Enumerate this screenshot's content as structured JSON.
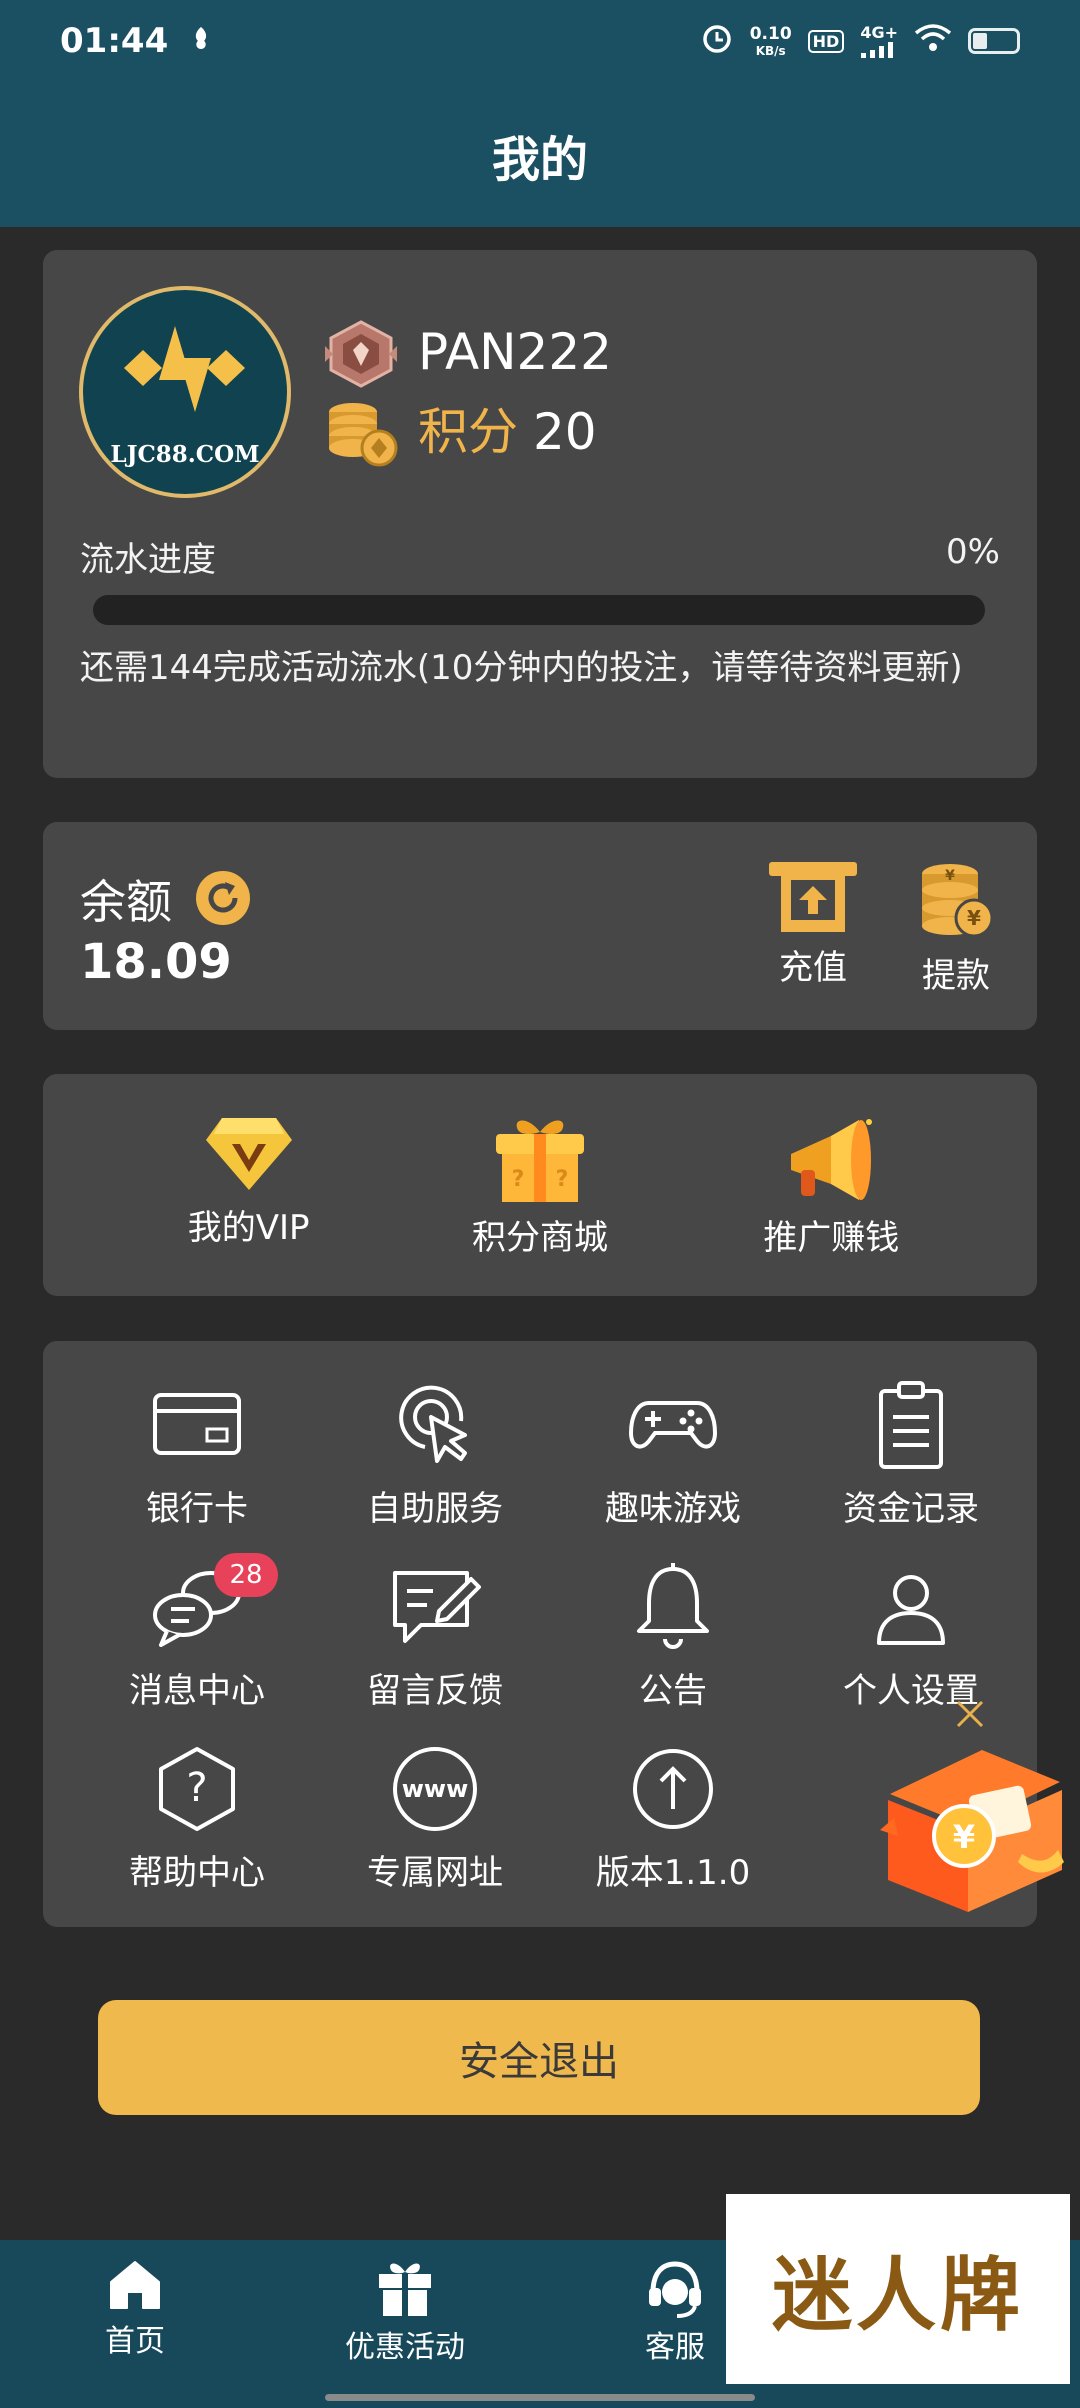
{
  "status_bar": {
    "time": "01:44",
    "net_speed_value": "0.10",
    "net_speed_unit": "KB/s",
    "hd": "HD",
    "signal": "4G+"
  },
  "header": {
    "title": "我的"
  },
  "profile": {
    "avatar_text": "LJC88.COM",
    "username": "PAN222",
    "points_label": "积分",
    "points_value": "20",
    "progress_label": "流水进度",
    "progress_percent_text": "0%",
    "progress_fraction": 0,
    "progress_note": "还需144完成活动流水(10分钟内的投注，请等待资料更新)"
  },
  "wallet": {
    "balance_label": "余额",
    "balance_value": "18.09",
    "deposit_label": "充值",
    "withdraw_label": "提款"
  },
  "quick_links": [
    {
      "label": "我的VIP",
      "icon": "vip-diamond-icon"
    },
    {
      "label": "积分商城",
      "icon": "gift-box-icon"
    },
    {
      "label": "推广赚钱",
      "icon": "megaphone-icon"
    }
  ],
  "grid_items": [
    {
      "label": "银行卡",
      "icon": "bank-card-icon"
    },
    {
      "label": "自助服务",
      "icon": "self-service-icon"
    },
    {
      "label": "趣味游戏",
      "icon": "gamepad-icon"
    },
    {
      "label": "资金记录",
      "icon": "clipboard-icon"
    },
    {
      "label": "消息中心",
      "icon": "chat-bubbles-icon",
      "badge": "28"
    },
    {
      "label": "留言反馈",
      "icon": "feedback-icon"
    },
    {
      "label": "公告",
      "icon": "bell-icon"
    },
    {
      "label": "个人设置",
      "icon": "person-icon"
    },
    {
      "label": "帮助中心",
      "icon": "help-icon"
    },
    {
      "label": "专属网址",
      "icon": "www-icon"
    },
    {
      "label": "版本1.1.0",
      "icon": "upload-arrow-icon"
    }
  ],
  "logout_label": "安全退出",
  "tabs": [
    {
      "label": "首页",
      "icon": "home-icon"
    },
    {
      "label": "优惠活动",
      "icon": "gift-icon"
    },
    {
      "label": "客服",
      "icon": "headset-icon"
    }
  ],
  "watermark": "迷人牌",
  "colors": {
    "header_bg": "#1b4f62",
    "card_bg": "#474747",
    "accent": "#f0b94d",
    "badge": "#e8425b"
  }
}
